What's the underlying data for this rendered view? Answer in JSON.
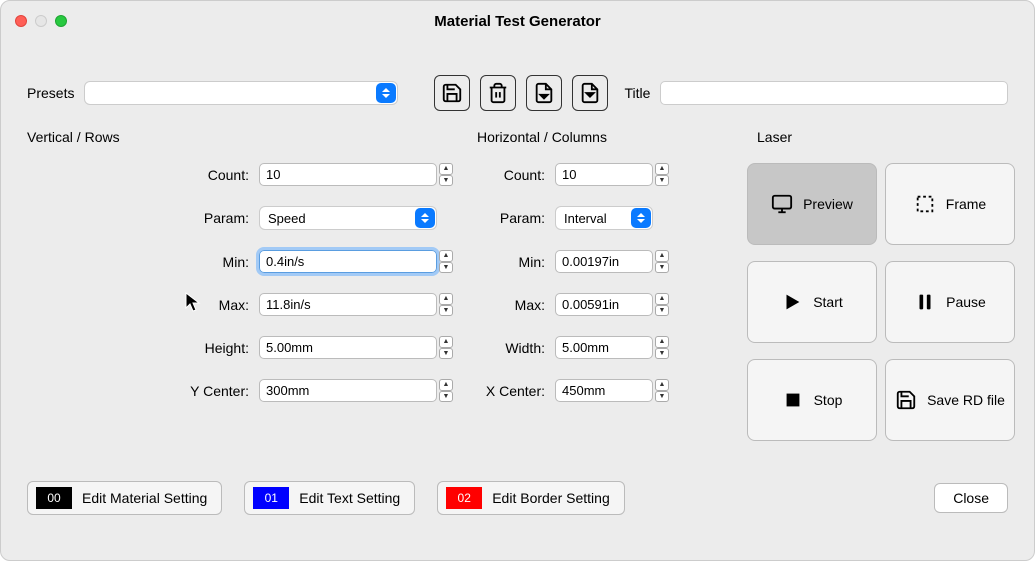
{
  "window": {
    "title": "Material Test Generator"
  },
  "presets": {
    "label": "Presets",
    "value": ""
  },
  "title_field": {
    "label": "Title",
    "value": ""
  },
  "sections": {
    "vertical_label": "Vertical / Rows",
    "horizontal_label": "Horizontal / Columns",
    "laser_label": "Laser"
  },
  "vertical": {
    "count": {
      "label": "Count:",
      "value": "10"
    },
    "param": {
      "label": "Param:",
      "value": "Speed"
    },
    "min": {
      "label": "Min:",
      "value": "0.4in/s"
    },
    "max": {
      "label": "Max:",
      "value": "11.8in/s"
    },
    "height": {
      "label": "Height:",
      "value": "5.00mm"
    },
    "ycenter": {
      "label": "Y Center:",
      "value": "300mm"
    }
  },
  "horizontal": {
    "count": {
      "label": "Count:",
      "value": "10"
    },
    "param": {
      "label": "Param:",
      "value": "Interval"
    },
    "min": {
      "label": "Min:",
      "value": "0.00197in"
    },
    "max": {
      "label": "Max:",
      "value": "0.00591in"
    },
    "width": {
      "label": "Width:",
      "value": "5.00mm"
    },
    "xcenter": {
      "label": "X Center:",
      "value": "450mm"
    }
  },
  "laser": {
    "preview": "Preview",
    "frame": "Frame",
    "start": "Start",
    "pause": "Pause",
    "stop": "Stop",
    "save": "Save RD file"
  },
  "edit": {
    "material": {
      "swatch": "00",
      "color": "#000000",
      "label": "Edit Material Setting"
    },
    "text": {
      "swatch": "01",
      "color": "#0000ff",
      "label": "Edit Text Setting"
    },
    "border": {
      "swatch": "02",
      "color": "#ff0000",
      "label": "Edit Border Setting"
    }
  },
  "close": "Close",
  "icons": {
    "save": "save-icon",
    "delete": "trash-icon",
    "import": "file-import-icon",
    "export": "file-export-icon"
  }
}
